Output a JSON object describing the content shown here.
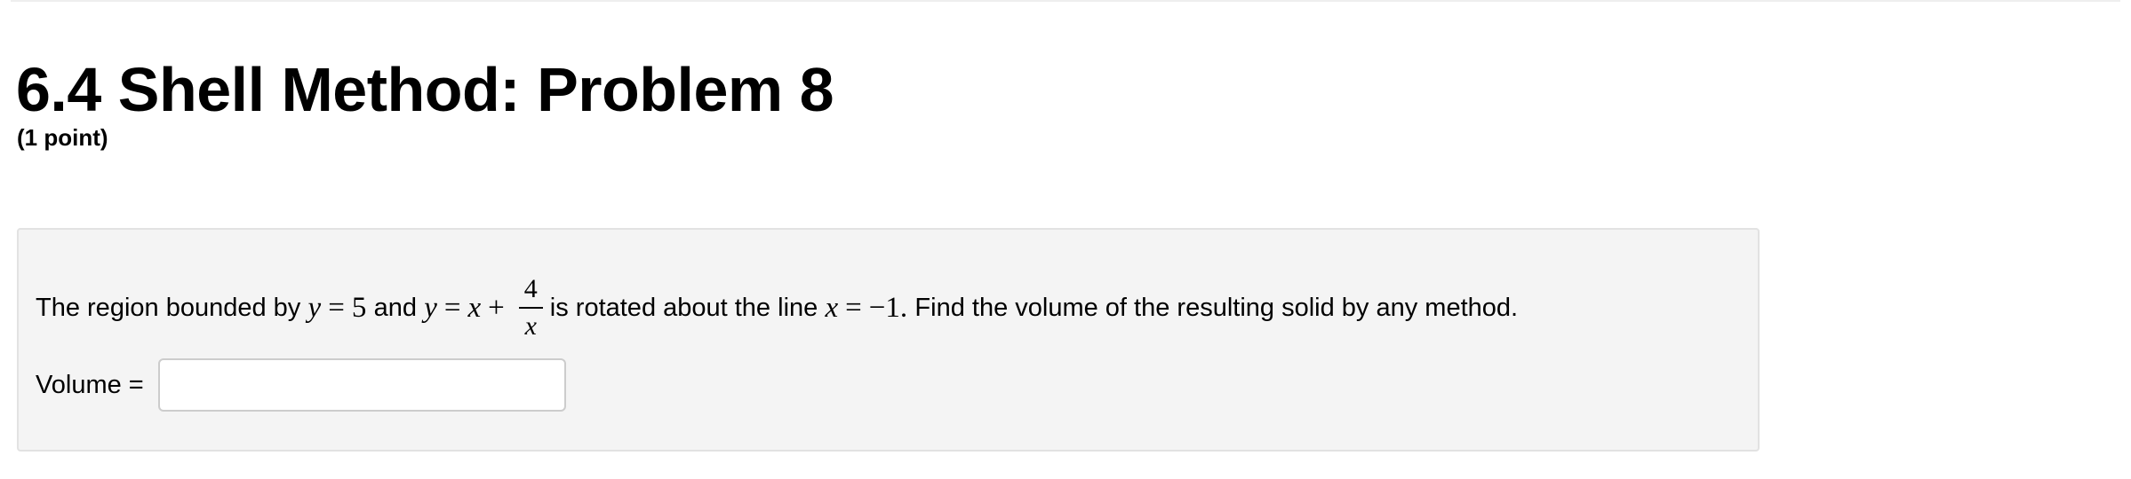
{
  "problem": {
    "title": "6.4 Shell Method: Problem 8",
    "points": "(1 point)",
    "statement": {
      "intro": "The region bounded by",
      "eq1_lhs": "y",
      "eq1_op": "=",
      "eq1_rhs": "5",
      "conjunction": "and",
      "eq2_lhs": "y",
      "eq2_op": "=",
      "eq2_x": "x",
      "eq2_plus": "+",
      "frac_num": "4",
      "frac_den": "x",
      "middle": "is rotated about the line",
      "eq3_lhs": "x",
      "eq3_op": "=",
      "eq3_rhs": "−1.",
      "outro": "Find the volume of the resulting solid by any method."
    },
    "answer": {
      "label": "Volume =",
      "value": "",
      "placeholder": ""
    }
  }
}
